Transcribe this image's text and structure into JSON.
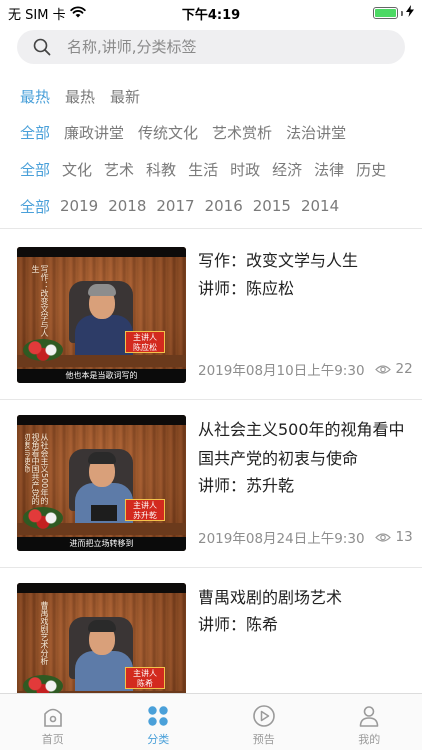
{
  "status_bar": {
    "carrier": "无 SIM 卡",
    "time": "下午4:19",
    "battery_color": "#4cd964"
  },
  "search": {
    "placeholder": "名称,讲师,分类标签",
    "value": ""
  },
  "filters": {
    "sort": [
      {
        "label": "最热",
        "active": true
      },
      {
        "label": "最热",
        "active": false
      },
      {
        "label": "最新",
        "active": false
      }
    ],
    "series": [
      {
        "label": "全部",
        "active": true
      },
      {
        "label": "廉政讲堂",
        "active": false
      },
      {
        "label": "传统文化",
        "active": false
      },
      {
        "label": "艺术赏析",
        "active": false
      },
      {
        "label": "法治讲堂",
        "active": false
      }
    ],
    "category": [
      {
        "label": "全部",
        "active": true
      },
      {
        "label": "文化",
        "active": false
      },
      {
        "label": "艺术",
        "active": false
      },
      {
        "label": "科教",
        "active": false
      },
      {
        "label": "生活",
        "active": false
      },
      {
        "label": "时政",
        "active": false
      },
      {
        "label": "经济",
        "active": false
      },
      {
        "label": "法律",
        "active": false
      },
      {
        "label": "历史",
        "active": false
      }
    ],
    "year": [
      {
        "label": "全部",
        "active": true
      },
      {
        "label": "2019",
        "active": false
      },
      {
        "label": "2018",
        "active": false
      },
      {
        "label": "2017",
        "active": false
      },
      {
        "label": "2016",
        "active": false
      },
      {
        "label": "2015",
        "active": false
      },
      {
        "label": "2014",
        "active": false
      }
    ]
  },
  "lectures": [
    {
      "title": "写作：改变文学与人生",
      "lecturer": "讲师：陈应松",
      "date": "2019年08月10日上午9:30",
      "views": "22",
      "thumb": {
        "vtext": "写作：改变文学与人生",
        "badge_top": "主讲人",
        "badge_name": "陈应松",
        "caption": "他也本是当歌词写的"
      }
    },
    {
      "title": "从社会主义500年的视角看中国共产党的初衷与使命",
      "lecturer": "讲师：苏升乾",
      "date": "2019年08月24日上午9:30",
      "views": "13",
      "thumb": {
        "vtext": "从社会主义500年的视角看中国共产党的初衷与使命",
        "badge_top": "主讲人",
        "badge_name": "苏升乾",
        "caption": "进而把立场转移到"
      }
    },
    {
      "title": "曹禺戏剧的剧场艺术",
      "lecturer": "讲师：陈希",
      "date": "",
      "views": "",
      "thumb": {
        "vtext": "曹禺戏剧艺术分析",
        "badge_top": "主讲人",
        "badge_name": "陈希",
        "caption": ""
      }
    }
  ],
  "tab_bar": {
    "active_color": "#4aa0d9",
    "tabs": [
      {
        "label": "首页",
        "icon": "home-icon",
        "active": false
      },
      {
        "label": "分类",
        "icon": "category-icon",
        "active": true
      },
      {
        "label": "预告",
        "icon": "play-icon",
        "active": false
      },
      {
        "label": "我的",
        "icon": "profile-icon",
        "active": false
      }
    ]
  }
}
